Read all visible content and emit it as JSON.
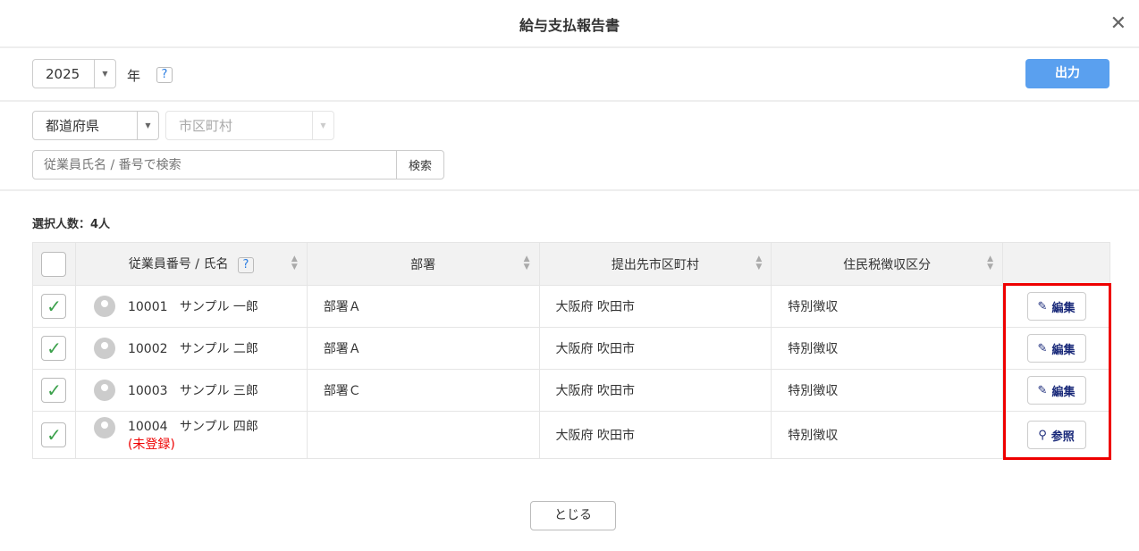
{
  "title": "給与支払報告書",
  "year": {
    "value": "2025",
    "unit": "年",
    "help": "?"
  },
  "output_button": "出力",
  "prefecture": "都道府県",
  "city_placeholder": "市区町村",
  "search": {
    "placeholder": "従業員氏名 / 番号で検索",
    "button": "検索"
  },
  "selected_count": "選択人数：4人",
  "table": {
    "headers": [
      "従業員番号 / 氏名",
      "部署",
      "提出先市区町村",
      "住民税徴収区分"
    ],
    "help": "?",
    "rows": [
      {
        "id": "10001",
        "name": "サンプル 一郎",
        "note": "",
        "dept": "部署Ａ",
        "city": "大阪府 吹田市",
        "tax": "特別徴収",
        "action": "編集",
        "icon": "pencil-icon"
      },
      {
        "id": "10002",
        "name": "サンプル 二郎",
        "note": "",
        "dept": "部署Ａ",
        "city": "大阪府 吹田市",
        "tax": "特別徴収",
        "action": "編集",
        "icon": "pencil-icon"
      },
      {
        "id": "10003",
        "name": "サンプル 三郎",
        "note": "",
        "dept": "部署Ｃ",
        "city": "大阪府 吹田市",
        "tax": "特別徴収",
        "action": "編集",
        "icon": "pencil-icon"
      },
      {
        "id": "10004",
        "name": "サンプル 四郎",
        "note": "(未登録)",
        "dept": "",
        "city": "大阪府 吹田市",
        "tax": "特別徴収",
        "action": "参照",
        "icon": "search-icon"
      }
    ]
  },
  "close_button": "とじる",
  "colors": {
    "accent": "#5aa0ef",
    "check": "#3aa04a",
    "highlight": "#e00000",
    "warning": "#e00000"
  }
}
